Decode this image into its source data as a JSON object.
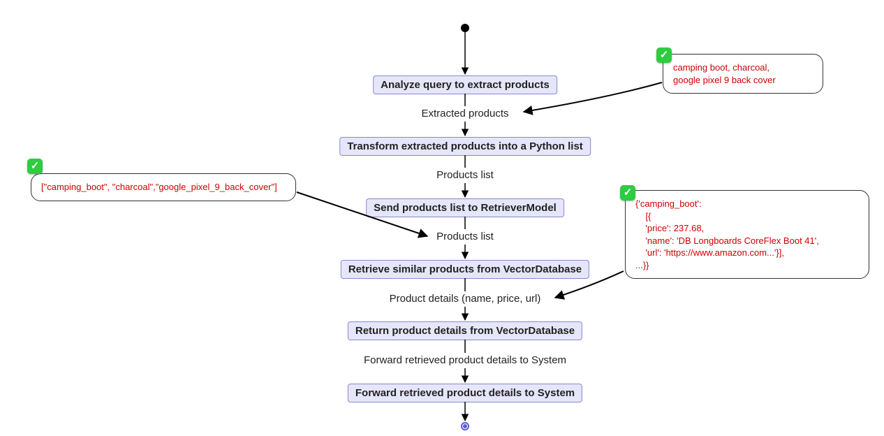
{
  "flow": {
    "nodes": [
      {
        "id": "n0",
        "label": "Analyze query to extract products"
      },
      {
        "id": "n1",
        "label": "Transform extracted products into a Python list"
      },
      {
        "id": "n2",
        "label": "Send products list to RetrieverModel"
      },
      {
        "id": "n3",
        "label": "Retrieve similar products from VectorDatabase"
      },
      {
        "id": "n4",
        "label": "Return product details from VectorDatabase"
      },
      {
        "id": "n5",
        "label": "Forward retrieved product details to System"
      }
    ],
    "edges": [
      {
        "id": "e0",
        "label": "Extracted products"
      },
      {
        "id": "e1",
        "label": "Products list"
      },
      {
        "id": "e2",
        "label": "Products list"
      },
      {
        "id": "e3",
        "label": "Product details (name, price, url)"
      },
      {
        "id": "e4",
        "label": "Forward retrieved product details to System"
      }
    ]
  },
  "notes": {
    "top_right": "camping boot, charcoal,\ngoogle pixel 9 back cover",
    "left": "[\"camping_boot\", \"charcoal\",\"google_pixel_9_back_cover\"]",
    "right": "{'camping_boot':\n    [{\n    'price': 237.68,\n    'name': 'DB Longboards CoreFlex Boot 41',\n    'url': 'https://www.amazon.com...'}],\n...}}"
  }
}
